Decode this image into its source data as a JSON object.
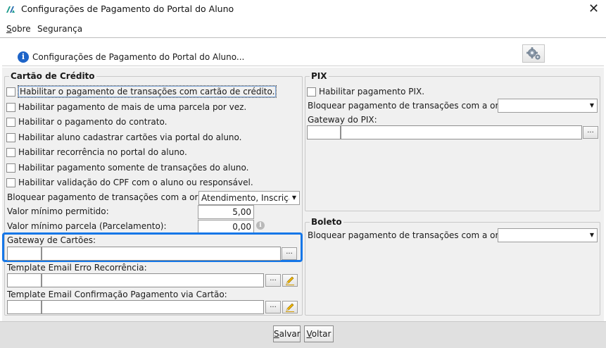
{
  "window": {
    "title": "Configurações de Pagamento do Portal do Aluno",
    "close_label": "✕"
  },
  "menubar": {
    "items": [
      {
        "label": "Sobre",
        "mnemonic": "S",
        "rest": "obre"
      },
      {
        "label": "Segurança"
      }
    ]
  },
  "header": {
    "title": "Configurações de Pagamento do Portal do Aluno...",
    "info_icon": "i"
  },
  "credit_card": {
    "legend": "Cartão de Crédito",
    "checkboxes": [
      {
        "label": "Habilitar o pagamento de transações com cartão de crédito.",
        "checked": false
      },
      {
        "label": "Habilitar pagamento de mais de uma parcela por vez.",
        "checked": false
      },
      {
        "label": "Habilitar o pagamento do contrato.",
        "checked": false
      },
      {
        "label": "Habilitar aluno cadastrar cartões via portal do aluno.",
        "checked": false
      },
      {
        "label": "Habilitar recorrência no portal do aluno.",
        "checked": false
      },
      {
        "label": "Habilitar pagamento somente de transações do aluno.",
        "checked": false
      },
      {
        "label": "Habilitar validação do CPF com o aluno ou responsável.",
        "checked": false
      }
    ],
    "block_origin_label": "Bloquear pagamento de transações com a origem:",
    "block_origin_value": "Atendimento, Inscrição...",
    "min_value_label": "Valor mínimo permitido:",
    "min_value": "5,00",
    "min_installment_label": "Valor mínimo parcela (Parcelamento):",
    "min_installment": "0,00",
    "hint_icon": "i",
    "gateway_label": "Gateway de Cartões:",
    "error_template_label": "Template Email Erro Recorrência:",
    "confirm_template_label": "Template Email Confirmação Pagamento via Cartão:",
    "ellipsis": "..."
  },
  "pix": {
    "legend": "PIX",
    "enable_label": "Habilitar pagamento PIX.",
    "block_origin_label": "Bloquear pagamento de transações com a origem:",
    "block_origin_value": "",
    "gateway_label": "Gateway do PIX:",
    "ellipsis": "..."
  },
  "boleto": {
    "legend": "Boleto",
    "block_origin_label": "Bloquear pagamento de transações com a origem:",
    "block_origin_value": ""
  },
  "footer": {
    "save": {
      "mnemonic": "S",
      "rest": "alvar"
    },
    "back": {
      "mnemonic": "V",
      "rest": "oltar"
    }
  },
  "colors": {
    "highlight": "#1677e8",
    "panel_bg": "#f0f0f0",
    "info_blue": "#1e64c8"
  }
}
